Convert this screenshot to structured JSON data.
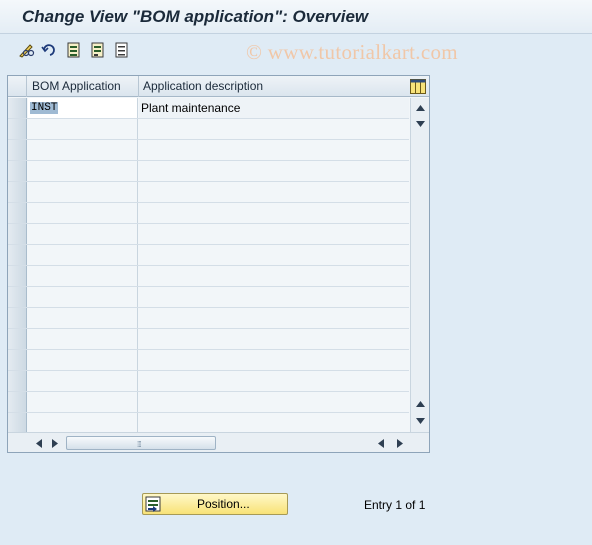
{
  "window": {
    "title": "Change View \"BOM application\": Overview"
  },
  "watermark": {
    "text": "© www.tutorialkart.com"
  },
  "toolbar": {
    "buttons": [
      {
        "icon": "pencil-glasses-icon"
      },
      {
        "icon": "undo-icon"
      },
      {
        "icon": "select-all-icon"
      },
      {
        "icon": "select-block-icon"
      },
      {
        "icon": "deselect-all-icon"
      }
    ]
  },
  "table": {
    "columns": [
      "BOM Application",
      "Application description"
    ],
    "rows": [
      {
        "bom_application": "INST",
        "description": "Plant maintenance"
      }
    ],
    "visible_row_count": 16
  },
  "position_button": {
    "label": "Position..."
  },
  "status": {
    "entry_text": "Entry 1 of 1"
  },
  "colors": {
    "background": "#dfebf5",
    "title_text": "#1b2a3a",
    "button_yellow": "#f8e277",
    "watermark": "#f0c7a8"
  }
}
